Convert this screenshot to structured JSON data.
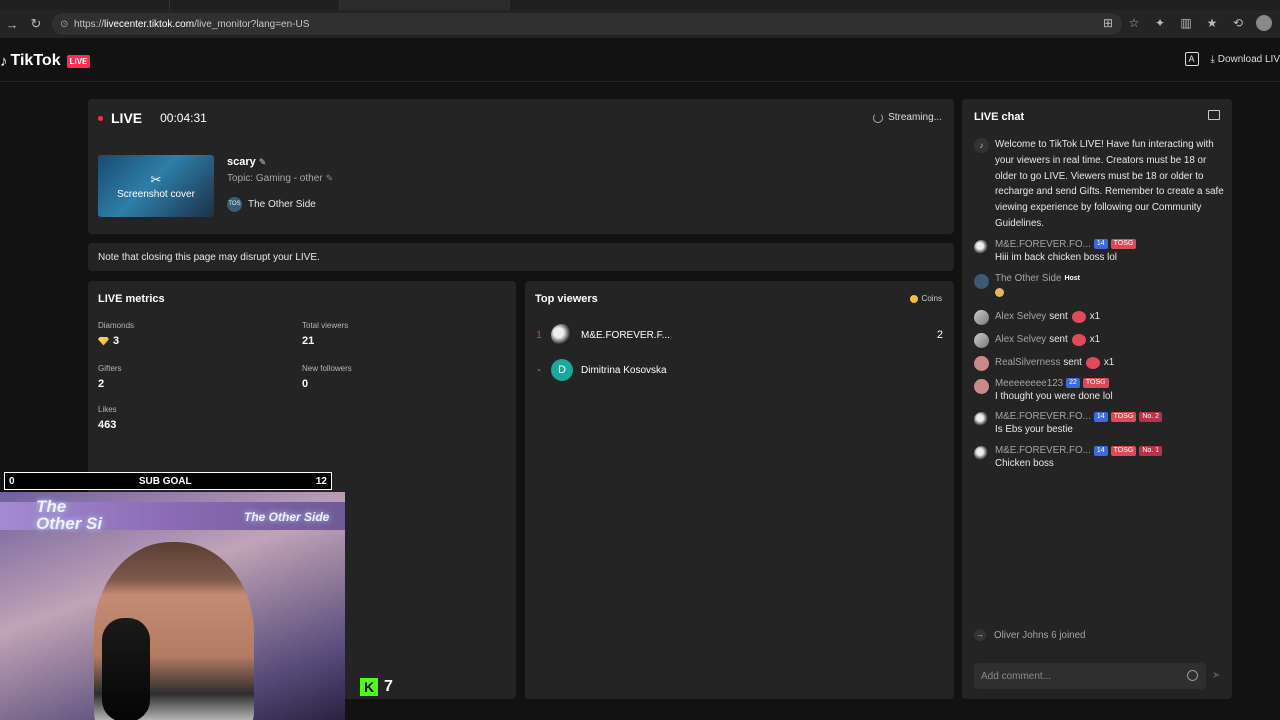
{
  "browser": {
    "url_host": "livecenter.tiktok.com",
    "url_path": "/live_monitor?lang=en-US"
  },
  "header": {
    "logo_text": "TikTok",
    "logo_badge": "LIVE",
    "download_label": "Download LIV"
  },
  "live_card": {
    "status": "LIVE",
    "timer": "00:04:31",
    "streaming_label": "Streaming...",
    "cover_label": "Screenshot cover",
    "title": "scary",
    "topic": "Topic: Gaming - other",
    "channel_name": "The Other Side"
  },
  "notice": "Note that closing this page may disrupt your LIVE.",
  "metrics": {
    "title": "LIVE metrics",
    "diamonds_label": "Diamonds",
    "diamonds_value": "3",
    "total_viewers_label": "Total viewers",
    "total_viewers_value": "21",
    "gifters_label": "Gifters",
    "gifters_value": "2",
    "new_followers_label": "New followers",
    "new_followers_value": "0",
    "likes_label": "Likes",
    "likes_value": "463"
  },
  "top_viewers": {
    "title": "Top viewers",
    "coins_label": "Coins",
    "rows": [
      {
        "rank": "1",
        "name": "M&E.FOREVER.F...",
        "count": "2"
      },
      {
        "rank": "-",
        "initial": "D",
        "name": "Dimitrina Kosovska",
        "count": ""
      }
    ]
  },
  "chat": {
    "title": "LIVE chat",
    "welcome": "Welcome to TikTok LIVE! Have fun interacting with your viewers in real time. Creators must be 18 or older to go LIVE. Viewers must be 18 or older to recharge and send Gifts. Remember to create a safe viewing experience by following our Community Guidelines.",
    "messages": [
      {
        "user": "M&E.FOREVER.FO...",
        "level": "14",
        "fan": "TOSG",
        "text": "Hiii im back chicken boss lol"
      },
      {
        "user": "The Other Side",
        "tag": "Host",
        "text": ""
      },
      {
        "user": "Alex Selvey",
        "gift": "sent",
        "qty": "x1"
      },
      {
        "user": "Alex Selvey",
        "gift": "sent",
        "qty": "x1"
      },
      {
        "user": "RealSilverness",
        "gift": "sent",
        "qty": "x1"
      },
      {
        "user": "Meeeeeeee123",
        "level": "22",
        "fan": "TOSG",
        "text": "I thought you were done lol"
      },
      {
        "user": "M&E.FOREVER.FO...",
        "level": "14",
        "fan": "TOSG",
        "rank": "No. 2",
        "text": "Is Ebs your bestie"
      },
      {
        "user": "M&E.FOREVER.FO...",
        "level": "14",
        "fan": "TOSG",
        "rank": "No. 1",
        "text": "Chicken boss"
      }
    ],
    "joined": "Oliver Johns 6 joined",
    "comment_placeholder": "Add comment..."
  },
  "overlay": {
    "goal_left": "0",
    "goal_label": "SUB GOAL",
    "goal_right": "12",
    "kick_count": "7",
    "neon_left": "The Other Si",
    "neon_right": "The Other Side"
  },
  "colors": {
    "accent": "#fe2c55",
    "panel": "#242424",
    "background": "#121212"
  }
}
